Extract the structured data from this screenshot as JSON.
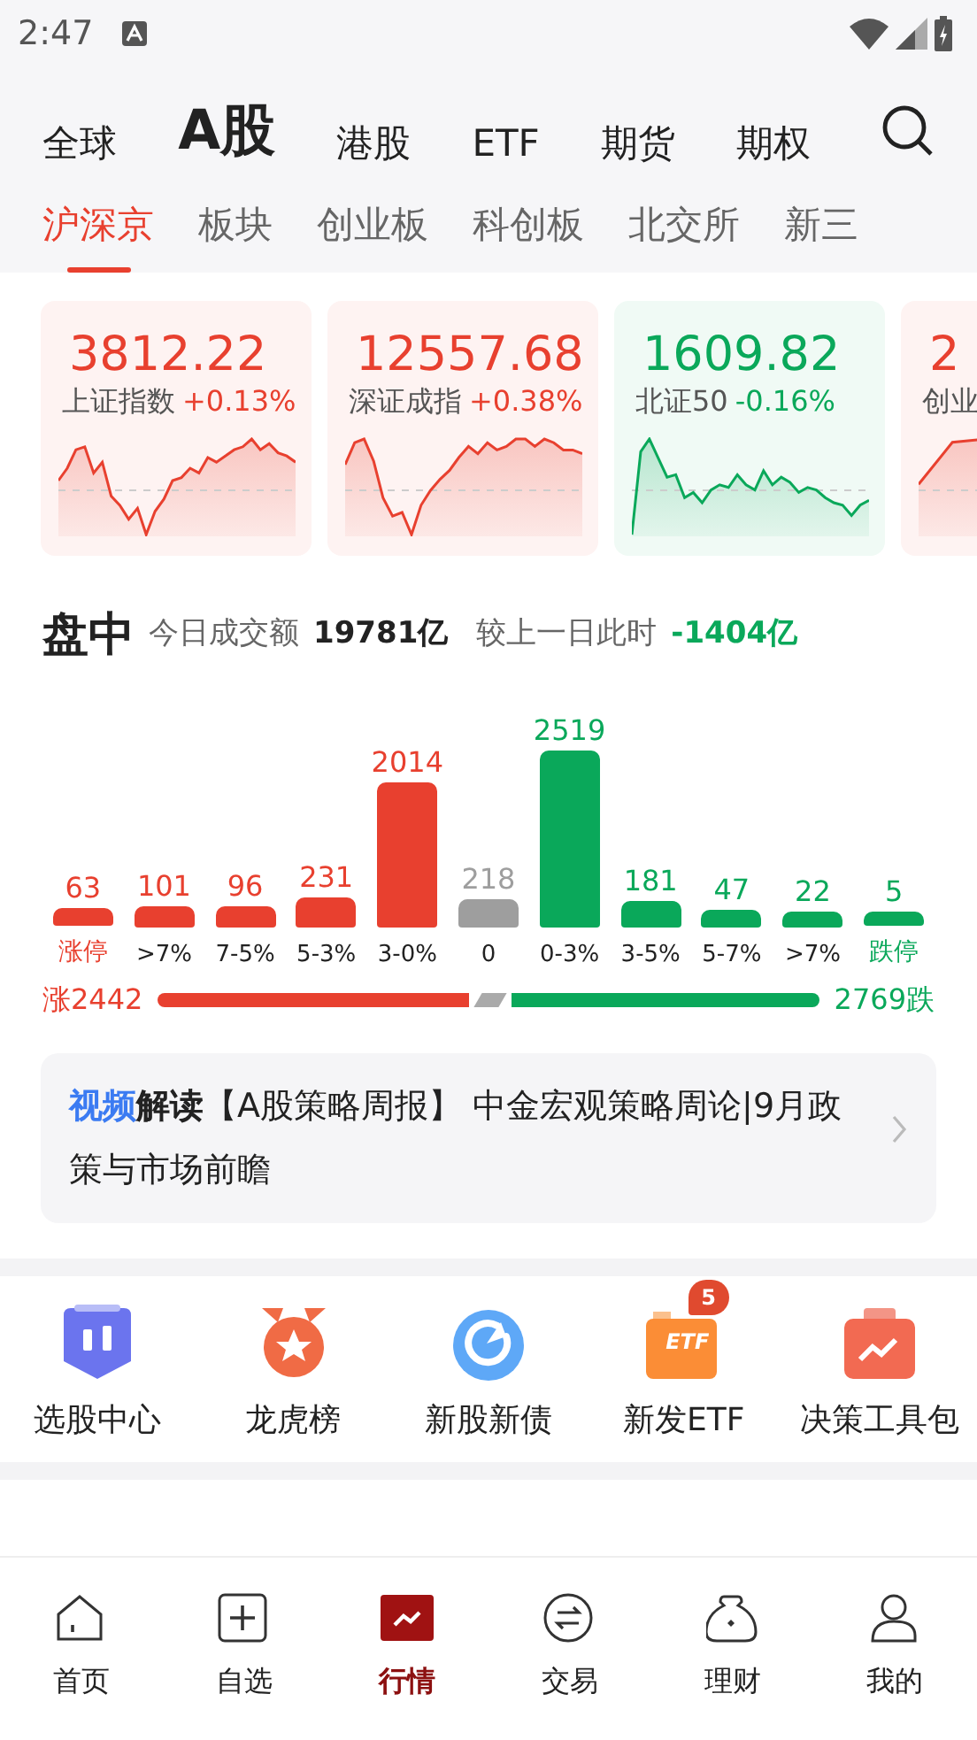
{
  "status_bar": {
    "time": "2:47"
  },
  "market_tabs": [
    {
      "label": "全球",
      "selected": false
    },
    {
      "label": "A股",
      "selected": true
    },
    {
      "label": "港股",
      "selected": false
    },
    {
      "label": "ETF",
      "selected": false
    },
    {
      "label": "期货",
      "selected": false
    },
    {
      "label": "期权",
      "selected": false
    }
  ],
  "sub_tabs": [
    {
      "label": "沪深京",
      "selected": true
    },
    {
      "label": "板块",
      "selected": false
    },
    {
      "label": "创业板",
      "selected": false
    },
    {
      "label": "科创板",
      "selected": false
    },
    {
      "label": "北交所",
      "selected": false
    },
    {
      "label": "新三",
      "selected": false
    }
  ],
  "index_cards": [
    {
      "value": "3812.22",
      "name": "上证指数",
      "change": "+0.13%",
      "color": "#e8402f"
    },
    {
      "value": "12557.68",
      "name": "深证成指",
      "change": "+0.38%",
      "color": "#e8402f"
    },
    {
      "value": "1609.82",
      "name": "北证50",
      "change": "-0.16%",
      "color": "#0aa85a"
    },
    {
      "value": "2",
      "name": "创业",
      "color": "#e8402f"
    }
  ],
  "session": {
    "title": "盘中",
    "turnover_label": "今日成交额",
    "turnover": "19781亿",
    "compare_label": "较上一日此时",
    "compare": "-1404亿"
  },
  "distribution": [
    {
      "label": "涨停",
      "count": "63",
      "color": "#e8402f",
      "limit": true
    },
    {
      "label": ">7%",
      "count": "101",
      "color": "#e8402f",
      "limit": false
    },
    {
      "label": "7-5%",
      "count": "96",
      "color": "#e8402f",
      "limit": false
    },
    {
      "label": "5-3%",
      "count": "231",
      "color": "#e8402f",
      "limit": false
    },
    {
      "label": "3-0%",
      "count": "2014",
      "color": "#e8402f",
      "limit": false
    },
    {
      "label": "0",
      "count": "218",
      "color": "#9e9e9e",
      "limit": false
    },
    {
      "label": "0-3%",
      "count": "2519",
      "color": "#0aa85a",
      "limit": false
    },
    {
      "label": "3-5%",
      "count": "181",
      "color": "#0aa85a",
      "limit": false
    },
    {
      "label": "5-7%",
      "count": "47",
      "color": "#0aa85a",
      "limit": false
    },
    {
      "label": ">7%",
      "count": "22",
      "color": "#0aa85a",
      "limit": false
    },
    {
      "label": "跌停",
      "count": "5",
      "color": "#0aa85a",
      "limit": true
    }
  ],
  "breadth": {
    "up_label": "涨2442",
    "down_label": "2769跌"
  },
  "news": {
    "tag_part1": "视频",
    "tag_part2": "解读",
    "text": "【A股策略周报】 中金宏观策略周论|9月政策与市场前瞻"
  },
  "shortcuts": [
    {
      "label": "选股中心",
      "kind": "candles"
    },
    {
      "label": "龙虎榜",
      "kind": "medal"
    },
    {
      "label": "新股新债",
      "kind": "refresh"
    },
    {
      "label": "新发ETF",
      "kind": "etf",
      "icon_text": "ETF",
      "badge": "5"
    },
    {
      "label": "决策工具包",
      "kind": "toolkit"
    }
  ],
  "bottom_nav": [
    {
      "label": "首页",
      "kind": "home",
      "selected": false
    },
    {
      "label": "自选",
      "kind": "add",
      "selected": false
    },
    {
      "label": "行情",
      "kind": "chart",
      "selected": true
    },
    {
      "label": "交易",
      "kind": "trade",
      "selected": false
    },
    {
      "label": "理财",
      "kind": "bag",
      "selected": false
    },
    {
      "label": "我的",
      "kind": "user",
      "selected": false
    }
  ]
}
